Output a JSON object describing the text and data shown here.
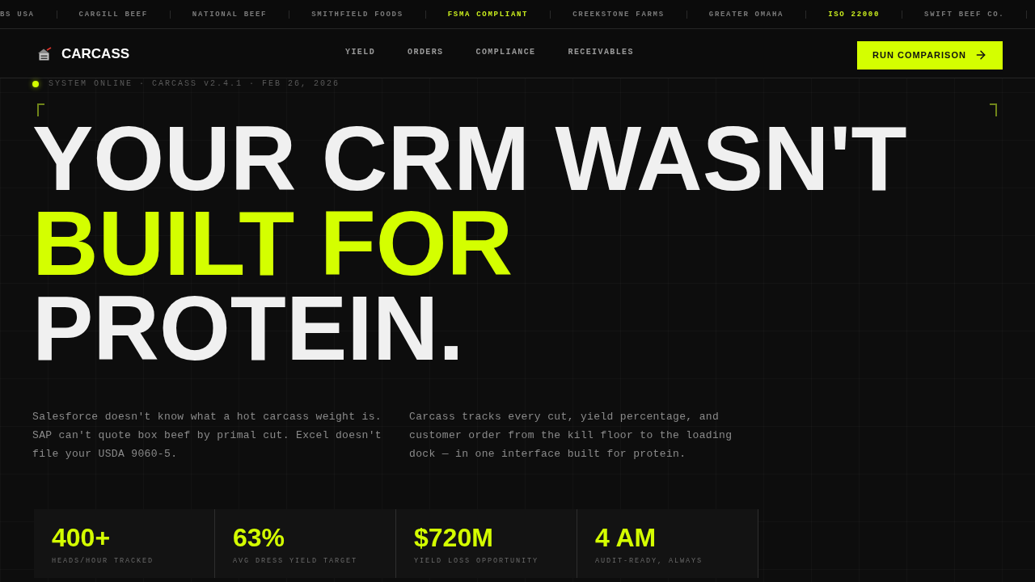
{
  "ticker": [
    {
      "text": "BS USA",
      "highlight": false
    },
    {
      "text": "CARGILL BEEF",
      "highlight": false
    },
    {
      "text": "NATIONAL BEEF",
      "highlight": false
    },
    {
      "text": "SMITHFIELD FOODS",
      "highlight": false
    },
    {
      "text": "FSMA COMPLIANT",
      "highlight": true
    },
    {
      "text": "CREEKSTONE FARMS",
      "highlight": false
    },
    {
      "text": "GREATER OMAHA",
      "highlight": false
    },
    {
      "text": "ISO 22000",
      "highlight": true
    },
    {
      "text": "SWIFT BEEF CO.",
      "highlight": false
    }
  ],
  "nav": {
    "brand": "CARCASS",
    "links": [
      "YIELD",
      "ORDERS",
      "COMPLIANCE",
      "RECEIVABLES"
    ],
    "cta": "RUN COMPARISON"
  },
  "status": {
    "online": true,
    "text": "SYSTEM ONLINE · CARCASS v2.4.1 · FEB 26, 2026"
  },
  "headline": [
    {
      "text": "YOUR CRM WASN'T",
      "highlight": false
    },
    {
      "text": "BUILT FOR",
      "highlight": true
    },
    {
      "text": "PROTEIN.",
      "highlight": false
    }
  ],
  "intro": [
    "Salesforce doesn't know what a hot carcass weight is. SAP can't quote box beef by primal cut. Excel doesn't file your USDA 9060-5.",
    "Carcass tracks every cut, yield percentage, and customer order from the kill floor to the loading dock — in one interface built for protein."
  ],
  "stats": [
    {
      "value": "400+",
      "label": "HEADS/HOUR TRACKED"
    },
    {
      "value": "63%",
      "label": "AVG DRESS YIELD TARGET"
    },
    {
      "value": "$720M",
      "label": "YIELD LOSS OPPORTUNITY"
    },
    {
      "value": "4 AM",
      "label": "AUDIT-READY, ALWAYS"
    }
  ]
}
